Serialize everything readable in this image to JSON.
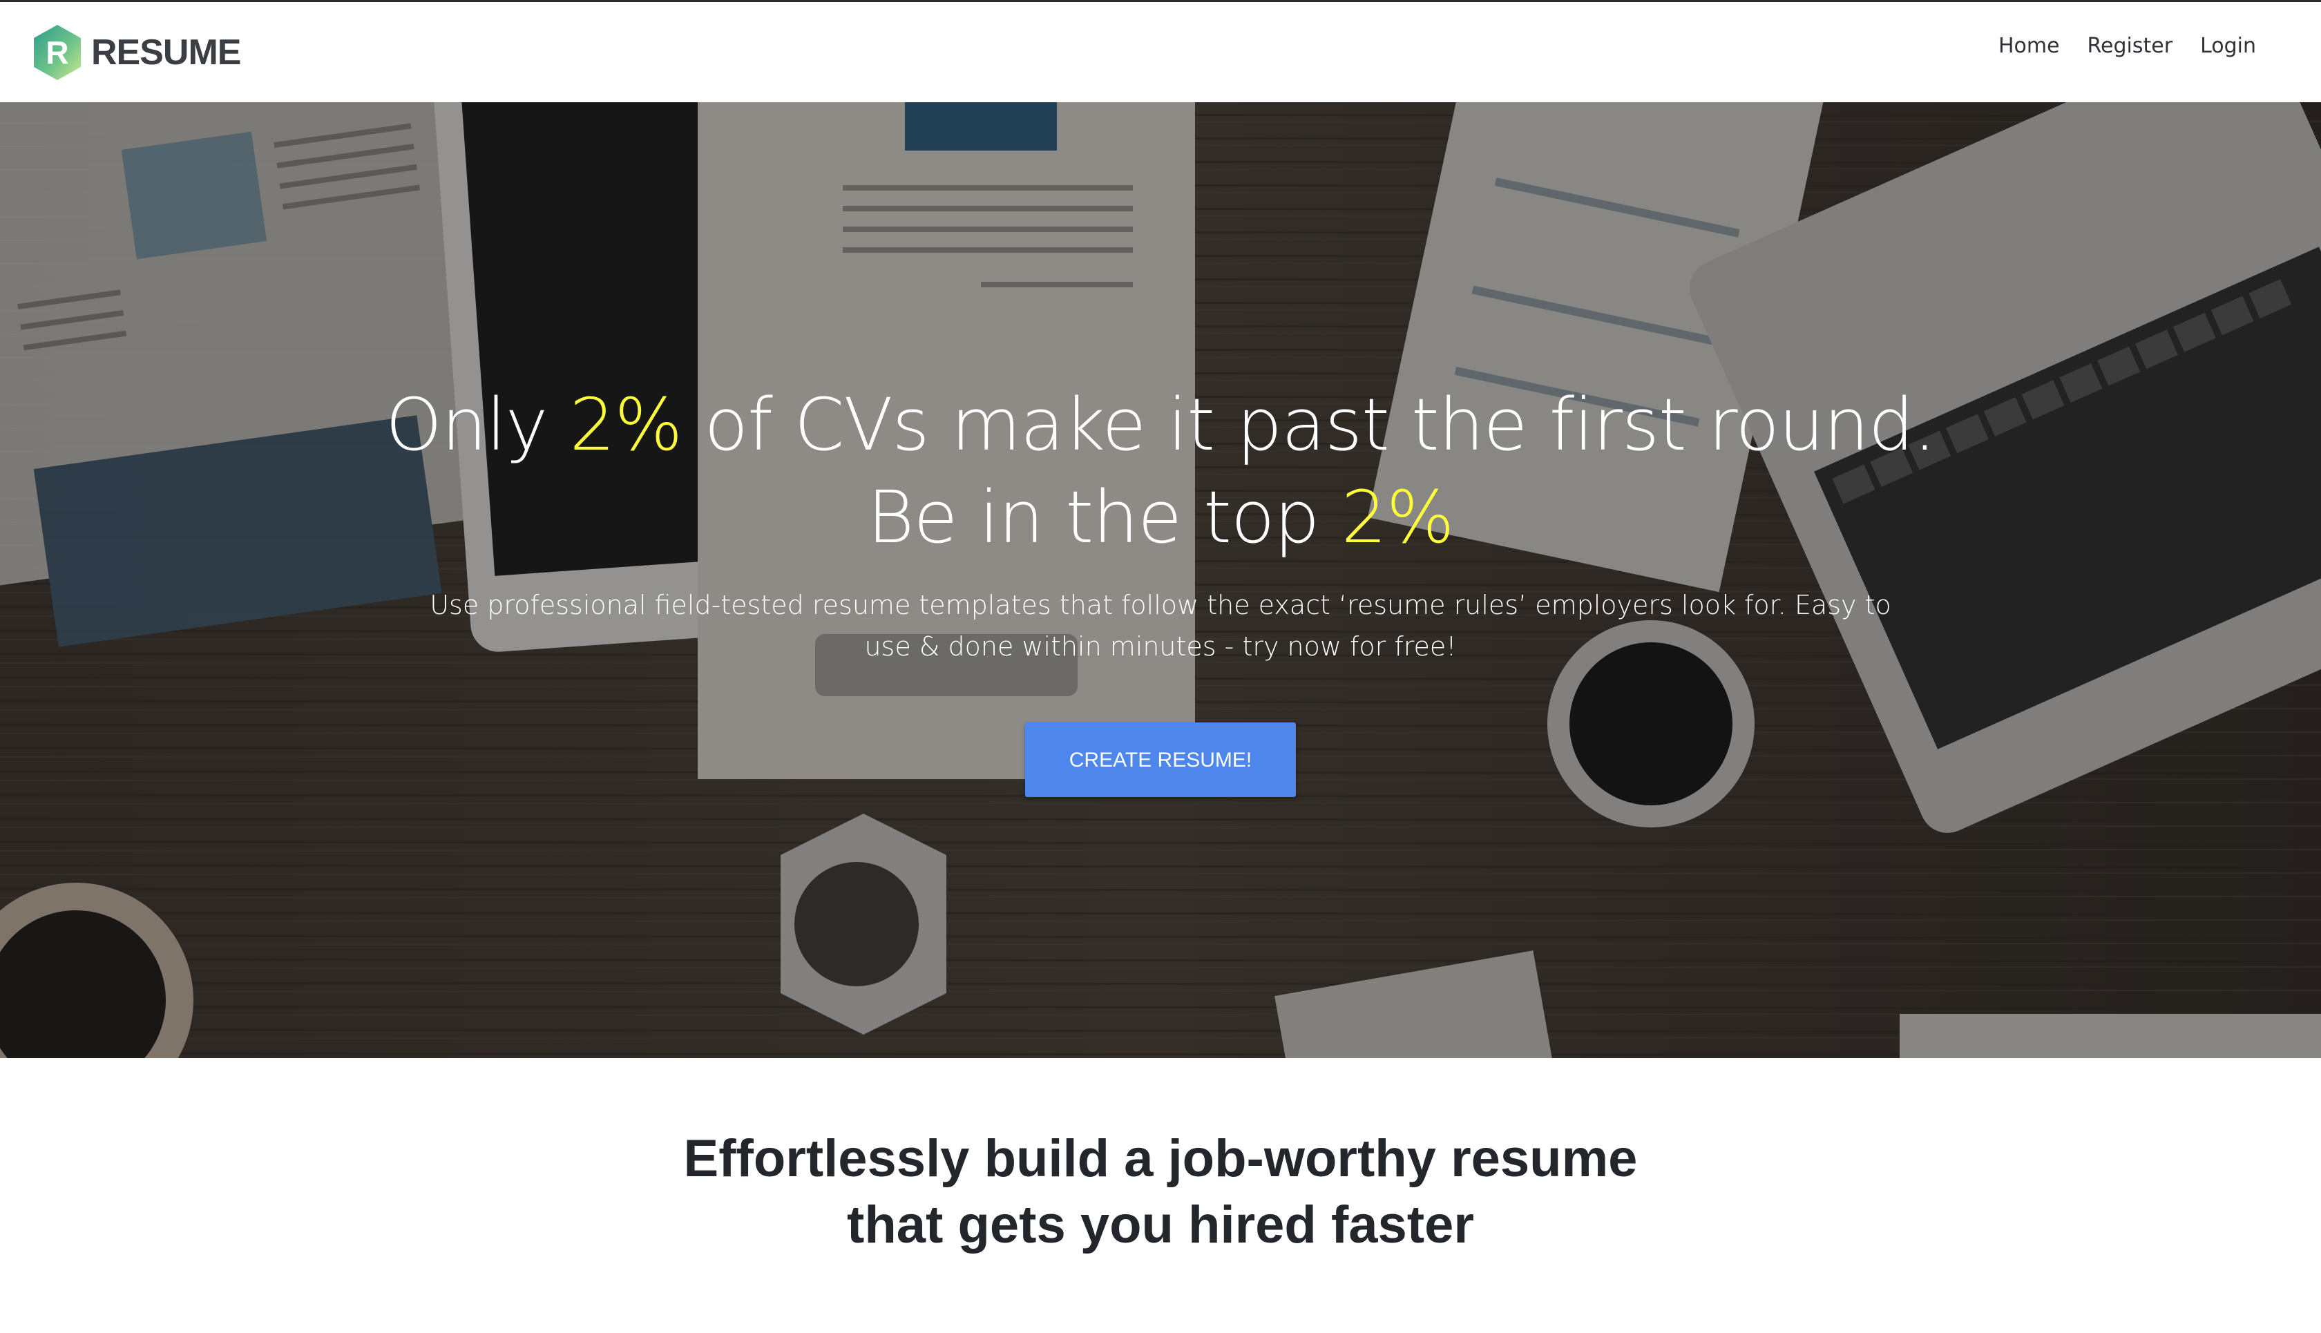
{
  "brand": {
    "logo_letter": "R",
    "name": "RESUME",
    "logo_colors": [
      "#3aa58b",
      "#8ed08a",
      "#c8e68a"
    ]
  },
  "nav": {
    "items": [
      {
        "label": "Home"
      },
      {
        "label": "Register"
      },
      {
        "label": "Login"
      }
    ]
  },
  "hero": {
    "headline_line1_prefix": "Only ",
    "headline_line1_highlight": "2%",
    "headline_line1_suffix": " of CVs make it past the first round.",
    "headline_line2_prefix": "Be in the top ",
    "headline_line2_highlight": "2%",
    "subtext": "Use professional field-tested resume templates that follow the exact ‘resume rules’ employers look for. Easy to use & done within minutes - try now for free!",
    "cta_label": "CREATE RESUME!",
    "highlight_color": "#ffff3a",
    "cta_color": "#4f86ec"
  },
  "feature": {
    "title_line1": "Effortlessly build a job-worthy resume",
    "title_line2": "that gets you hired faster"
  }
}
